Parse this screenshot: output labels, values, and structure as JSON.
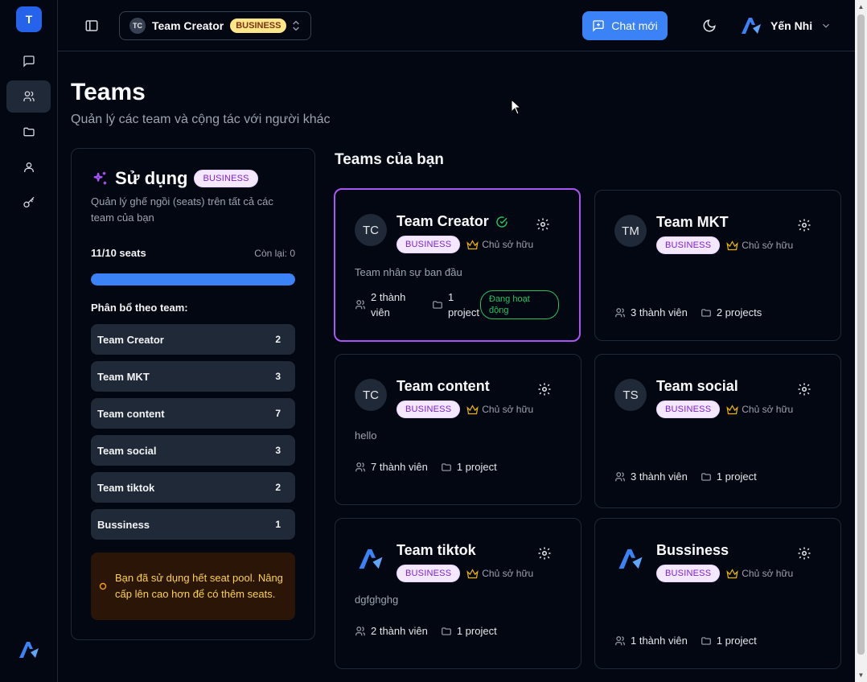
{
  "rail": {
    "avatar_letter": "T",
    "items": [
      {
        "icon": "chat-icon"
      },
      {
        "icon": "users-icon",
        "active": true
      },
      {
        "icon": "folder-icon"
      },
      {
        "icon": "user-icon"
      },
      {
        "icon": "key-icon"
      }
    ]
  },
  "topbar": {
    "team_switch": {
      "initials": "TC",
      "name": "Team Creator",
      "plan": "BUSINESS"
    },
    "chat_button": "Chat mới",
    "user_name": "Yến Nhi"
  },
  "header": {
    "title": "Teams",
    "subtitle": "Quản lý các team và cộng tác với người khác"
  },
  "usage": {
    "title": "Sử dụng",
    "plan": "BUSINESS",
    "description": "Quản lý ghế ngồi (seats) trên tất cả các team của bạn",
    "seats_label": "11/10 seats",
    "remaining_label": "Còn lại: 0",
    "progress_fraction": 1.0,
    "allocation_title": "Phân bổ theo team:",
    "allocation": [
      {
        "name": "Team Creator",
        "count": "2"
      },
      {
        "name": "Team MKT",
        "count": "3"
      },
      {
        "name": "Team content",
        "count": "7"
      },
      {
        "name": "Team social",
        "count": "3"
      },
      {
        "name": "Team tiktok",
        "count": "2"
      },
      {
        "name": "Bussiness",
        "count": "1"
      }
    ],
    "warning": "Bạn đã sử dụng hết seat pool. Nâng cấp lên cao hơn để có thêm seats."
  },
  "teams_section": {
    "title": "Teams của bạn",
    "cards": [
      {
        "initials": "TC",
        "name": "Team Creator",
        "plan": "BUSINESS",
        "role": "Chủ sở hữu",
        "description": "Team nhân sự ban đầu",
        "members": "2 thành viên",
        "projects": "1 project",
        "status": "Đang hoạt động"
      },
      {
        "initials": "TM",
        "name": "Team MKT",
        "plan": "BUSINESS",
        "role": "Chủ sở hữu",
        "description": "",
        "members": "3 thành viên",
        "projects": "2 projects"
      },
      {
        "initials": "TC",
        "name": "Team content",
        "plan": "BUSINESS",
        "role": "Chủ sở hữu",
        "description": "hello",
        "members": "7 thành viên",
        "projects": "1 project"
      },
      {
        "initials": "TS",
        "name": "Team social",
        "plan": "BUSINESS",
        "role": "Chủ sở hữu",
        "description": "",
        "members": "3 thành viên",
        "projects": "1 project"
      },
      {
        "initials": "",
        "name": "Team tiktok",
        "plan": "BUSINESS",
        "role": "Chủ sở hữu",
        "description": "dgfghghg",
        "members": "2 thành viên",
        "projects": "1 project"
      },
      {
        "initials": "",
        "name": "Bussiness",
        "plan": "BUSINESS",
        "role": "Chủ sở hữu",
        "description": "",
        "members": "1 thành viên",
        "projects": "1 project"
      }
    ]
  },
  "colors": {
    "accent": "#3b82f6",
    "selected_border": "#a855f7",
    "active_green": "#22c55e",
    "warning_text": "#fcd34d"
  }
}
